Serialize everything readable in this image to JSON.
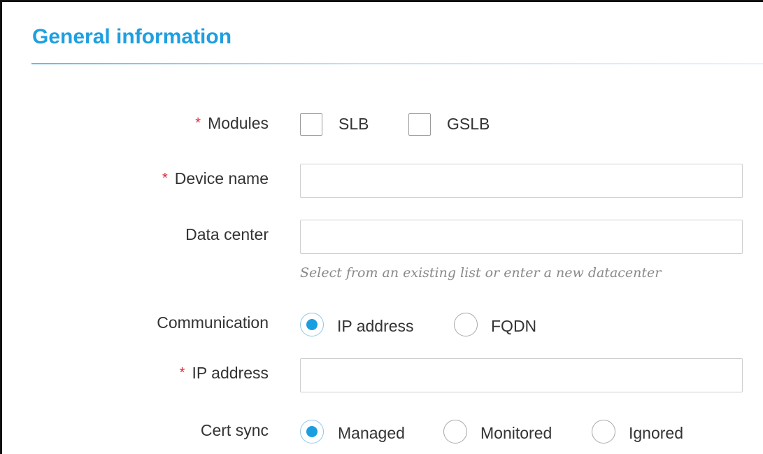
{
  "section": {
    "title": "General information"
  },
  "form": {
    "required_marker": "*",
    "modules": {
      "label": "Modules",
      "options": [
        {
          "label": "SLB",
          "checked": false
        },
        {
          "label": "GSLB",
          "checked": false
        }
      ]
    },
    "device_name": {
      "label": "Device name",
      "value": "",
      "placeholder": ""
    },
    "data_center": {
      "label": "Data center",
      "value": "",
      "placeholder": "",
      "hint": "Select from an existing list or enter a new datacenter"
    },
    "communication": {
      "label": "Communication",
      "options": [
        {
          "label": "IP address",
          "checked": true
        },
        {
          "label": "FQDN",
          "checked": false
        }
      ]
    },
    "ip_address": {
      "label": "IP address",
      "value": "",
      "placeholder": ""
    },
    "cert_sync": {
      "label": "Cert sync",
      "options": [
        {
          "label": "Managed",
          "checked": true
        },
        {
          "label": "Monitored",
          "checked": false
        },
        {
          "label": "Ignored",
          "checked": false
        }
      ]
    }
  },
  "colors": {
    "accent": "#1e9fe0",
    "required": "#e0263a",
    "radio_selected": "#1b9ee0"
  }
}
